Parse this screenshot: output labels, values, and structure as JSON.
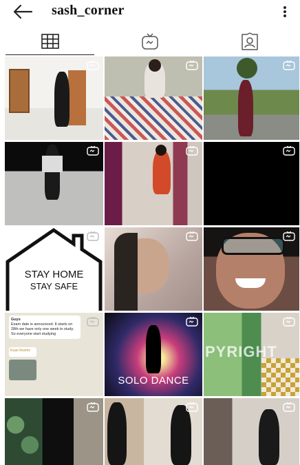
{
  "header": {
    "username": "sash_corner",
    "back_icon": "arrow-left-icon",
    "more_icon": "more-vertical-icon"
  },
  "tabs": [
    {
      "icon": "grid-icon",
      "active": true
    },
    {
      "icon": "igtv-icon",
      "active": false
    },
    {
      "icon": "tagged-icon",
      "active": false
    }
  ],
  "grid": {
    "posts": [
      {
        "badge": "igtv-icon"
      },
      {
        "badge": "igtv-icon"
      },
      {
        "badge": "igtv-icon"
      },
      {
        "badge": "igtv-icon"
      },
      {
        "badge": "igtv-icon"
      },
      {
        "badge": "igtv-icon"
      },
      {
        "badge": "igtv-icon",
        "line1": "STAY HOME",
        "line2": "STAY SAFE"
      },
      {
        "badge": "igtv-icon"
      },
      {
        "badge": "igtv-icon"
      },
      {
        "badge": "igtv-icon",
        "chat_title": "Guys",
        "chat_text": "Exam date is announced. It starts on 28th we have only one week to study. So everyone start studying",
        "chat_name": "Kuan Roshni"
      },
      {
        "badge": "igtv-icon",
        "caption": "SOLO DANCE"
      },
      {
        "badge": "igtv-icon",
        "watermark": "PYRIGHT"
      },
      {
        "badge": "igtv-icon"
      },
      {
        "badge": "igtv-icon"
      },
      {
        "badge": "igtv-icon"
      }
    ]
  },
  "colors": {
    "background": "#ffffff",
    "text": "#111111",
    "icon": "#222222"
  }
}
